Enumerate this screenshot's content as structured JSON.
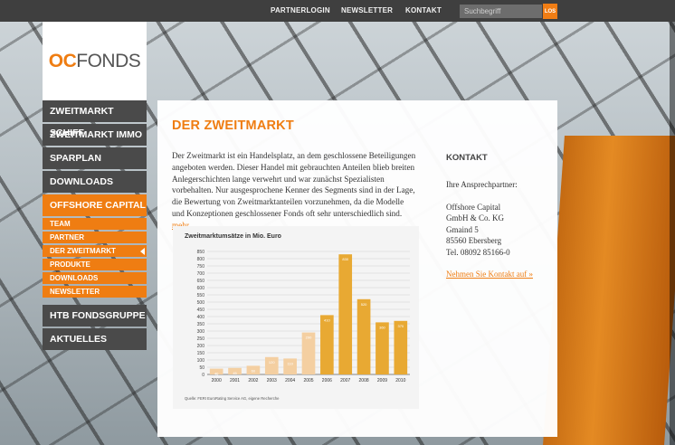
{
  "topnav": {
    "links": [
      "PARTNERLOGIN",
      "NEWSLETTER",
      "KONTAKT"
    ],
    "search_placeholder": "Suchbegriff",
    "search_button": "LOS"
  },
  "logo": {
    "oc": "OC",
    "fonds": "FONDS"
  },
  "sidebar": {
    "items": [
      "ZWEITMARKT SCHIFF",
      "ZWEITMARKT IMMO",
      "SPARPLAN",
      "DOWNLOADS",
      "OFFSHORE CAPITAL"
    ],
    "subitems": [
      "TEAM",
      "PARTNER",
      "DER ZWEITMARKT",
      "PRODUKTE",
      "DOWNLOADS",
      "NEWSLETTER"
    ],
    "items_after": [
      "HTB FONDSGRUPPE",
      "AKTUELLES"
    ]
  },
  "main": {
    "title": "DER ZWEITMARKT",
    "intro": "Der Zweitmarkt ist ein Handelsplatz, an dem geschlossene Beteiligungen angeboten werden. Dieser Handel mit gebrauchten Anteilen blieb breiten Anlegerschichten lange verwehrt und war zunächst Spezialisten vorbehalten. Nur ausgesprochene Kenner des Segments sind in der Lage, die Bewertung von Zweitmarktanteilen vorzunehmen, da die Modelle und Konzeptionen geschlossener Fonds oft sehr unterschiedlich sind.",
    "more": "mehr"
  },
  "contact": {
    "heading": "KONTAKT",
    "subheading": "Ihre Ansprechpartner:",
    "address": [
      "Offshore Capital",
      "GmbH & Co. KG",
      "Gmaind 5",
      "85560 Ebersberg",
      "Tel. 08092 85166-0"
    ],
    "link": "Nehmen Sie Kontakt auf »"
  },
  "chart_data": {
    "type": "bar",
    "title": "Zweitmarktumsätze in Mio. Euro",
    "categories": [
      "2000",
      "2001",
      "2002",
      "2003",
      "2004",
      "2005",
      "2006",
      "2007",
      "2008",
      "2009",
      "2010"
    ],
    "values": [
      40,
      45,
      60,
      120,
      110,
      290,
      410,
      830,
      520,
      360,
      370
    ],
    "ylim": [
      0,
      850
    ],
    "yticks": [
      0,
      50,
      100,
      150,
      200,
      250,
      300,
      350,
      400,
      450,
      500,
      550,
      600,
      650,
      700,
      750,
      800,
      850
    ],
    "source": "Quelle: FERI EuroRating Service AG, eigene Recherche",
    "colors": {
      "early": "#f4cfa1",
      "late": "#e8a933"
    }
  }
}
